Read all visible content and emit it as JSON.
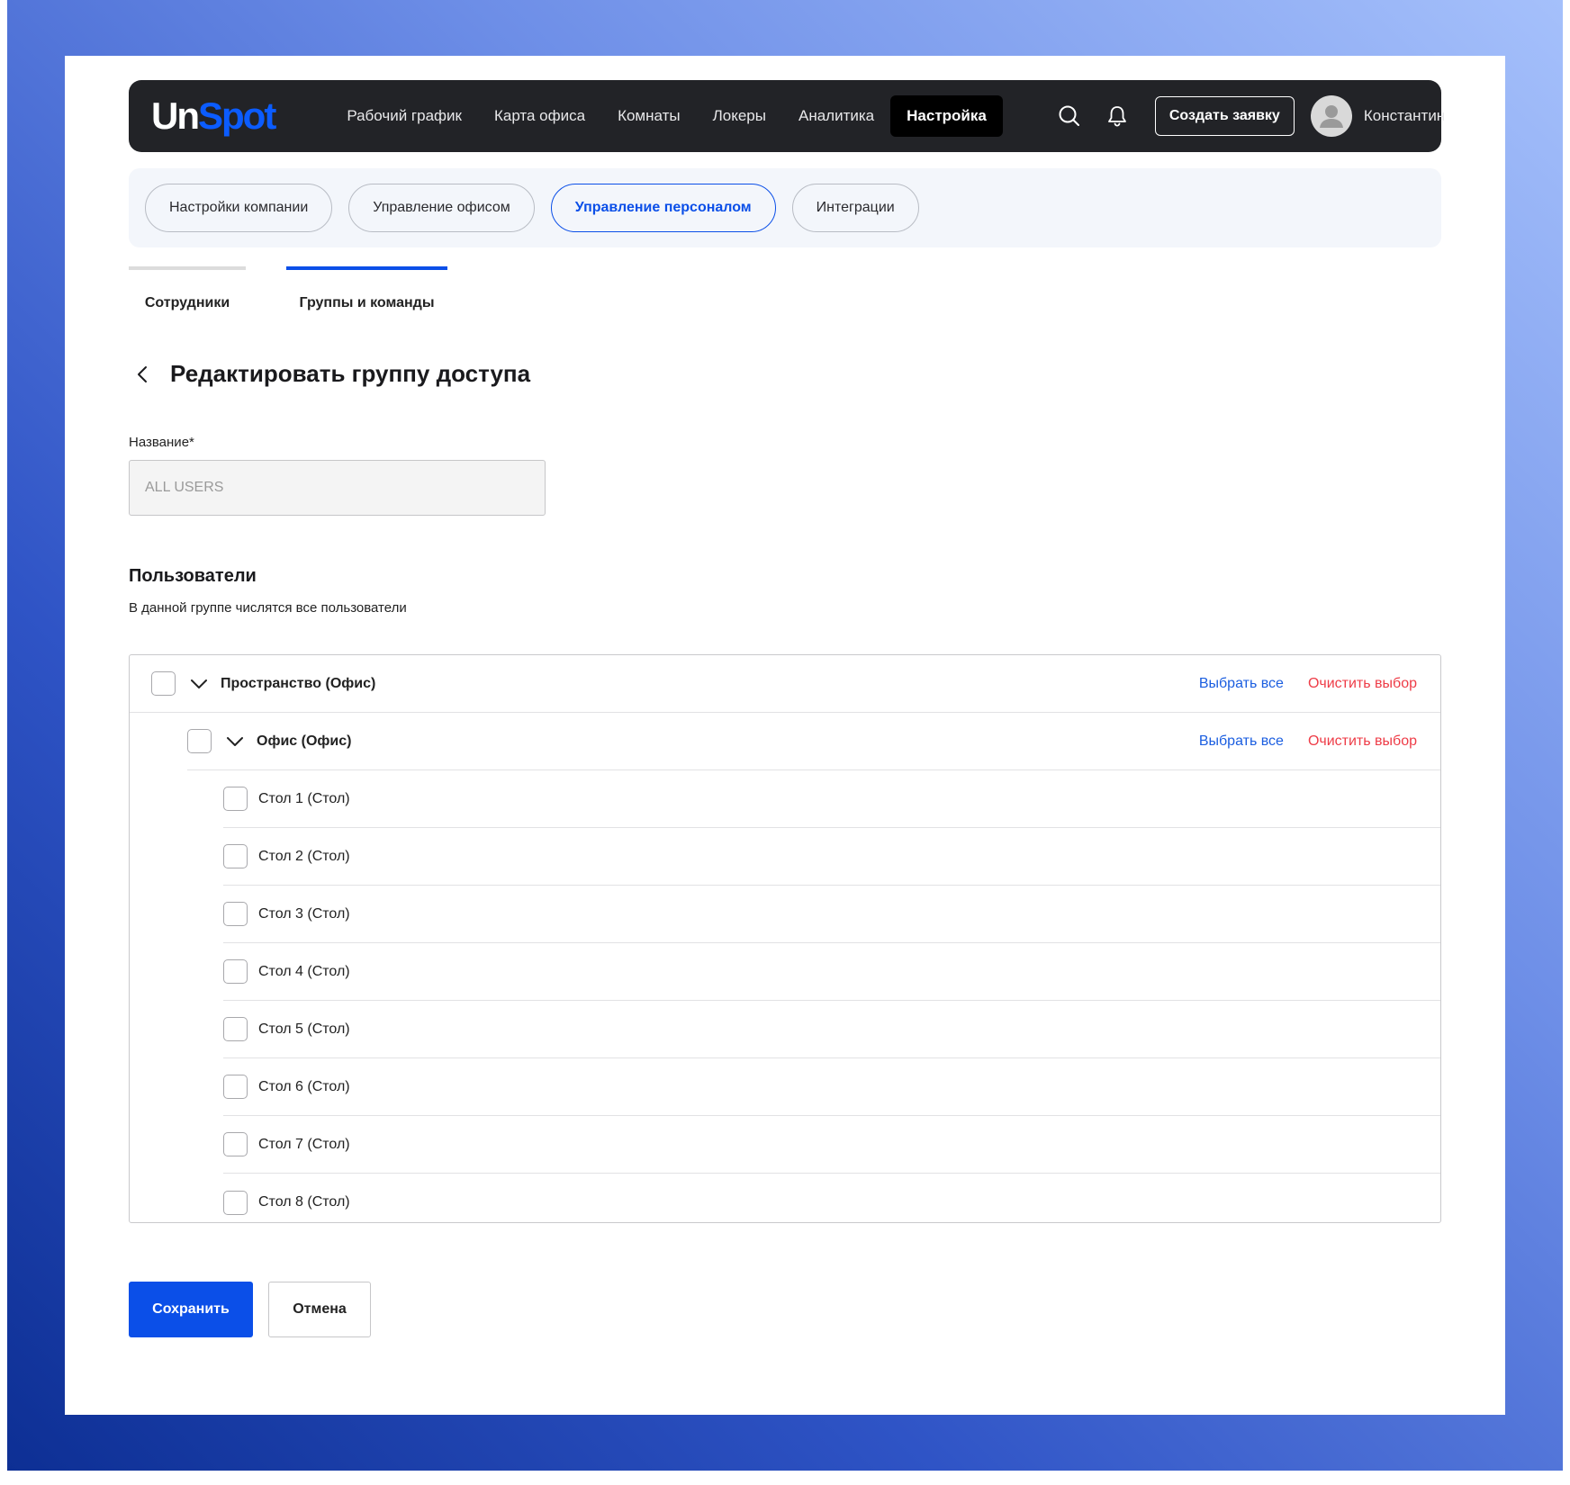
{
  "brand": {
    "part1": "Un",
    "part2": "Spot"
  },
  "nav": {
    "links": [
      "Рабочий график",
      "Карта офиса",
      "Комнаты",
      "Локеры",
      "Аналитика",
      "Настройка"
    ],
    "create_label": "Создать заявку",
    "user_name": "Константин"
  },
  "subnav": [
    "Настройки компании",
    "Управление офисом",
    "Управление персоналом",
    "Интеграции"
  ],
  "tabs": [
    "Сотрудники",
    "Группы и команды"
  ],
  "page": {
    "title": "Редактировать группу доступа",
    "name_label": "Название*",
    "name_placeholder": "ALL USERS",
    "users_title": "Пользователи",
    "users_subtitle": "В данной группе числятся все пользователи"
  },
  "tree": {
    "select_all": "Выбрать все",
    "clear": "Очистить выбор",
    "root": "Пространство (Офис)",
    "office": "Офис (Офис)",
    "items": [
      "Стол 1 (Стол)",
      "Стол 2 (Стол)",
      "Стол 3 (Стол)",
      "Стол 4 (Стол)",
      "Стол 5 (Стол)",
      "Стол 6 (Стол)",
      "Стол 7 (Стол)",
      "Стол 8 (Стол)"
    ]
  },
  "actions": {
    "save": "Сохранить",
    "cancel": "Отмена"
  },
  "colors": {
    "accent": "#0b4fe8",
    "danger": "#ee3c47",
    "nav_bg": "#222327"
  }
}
